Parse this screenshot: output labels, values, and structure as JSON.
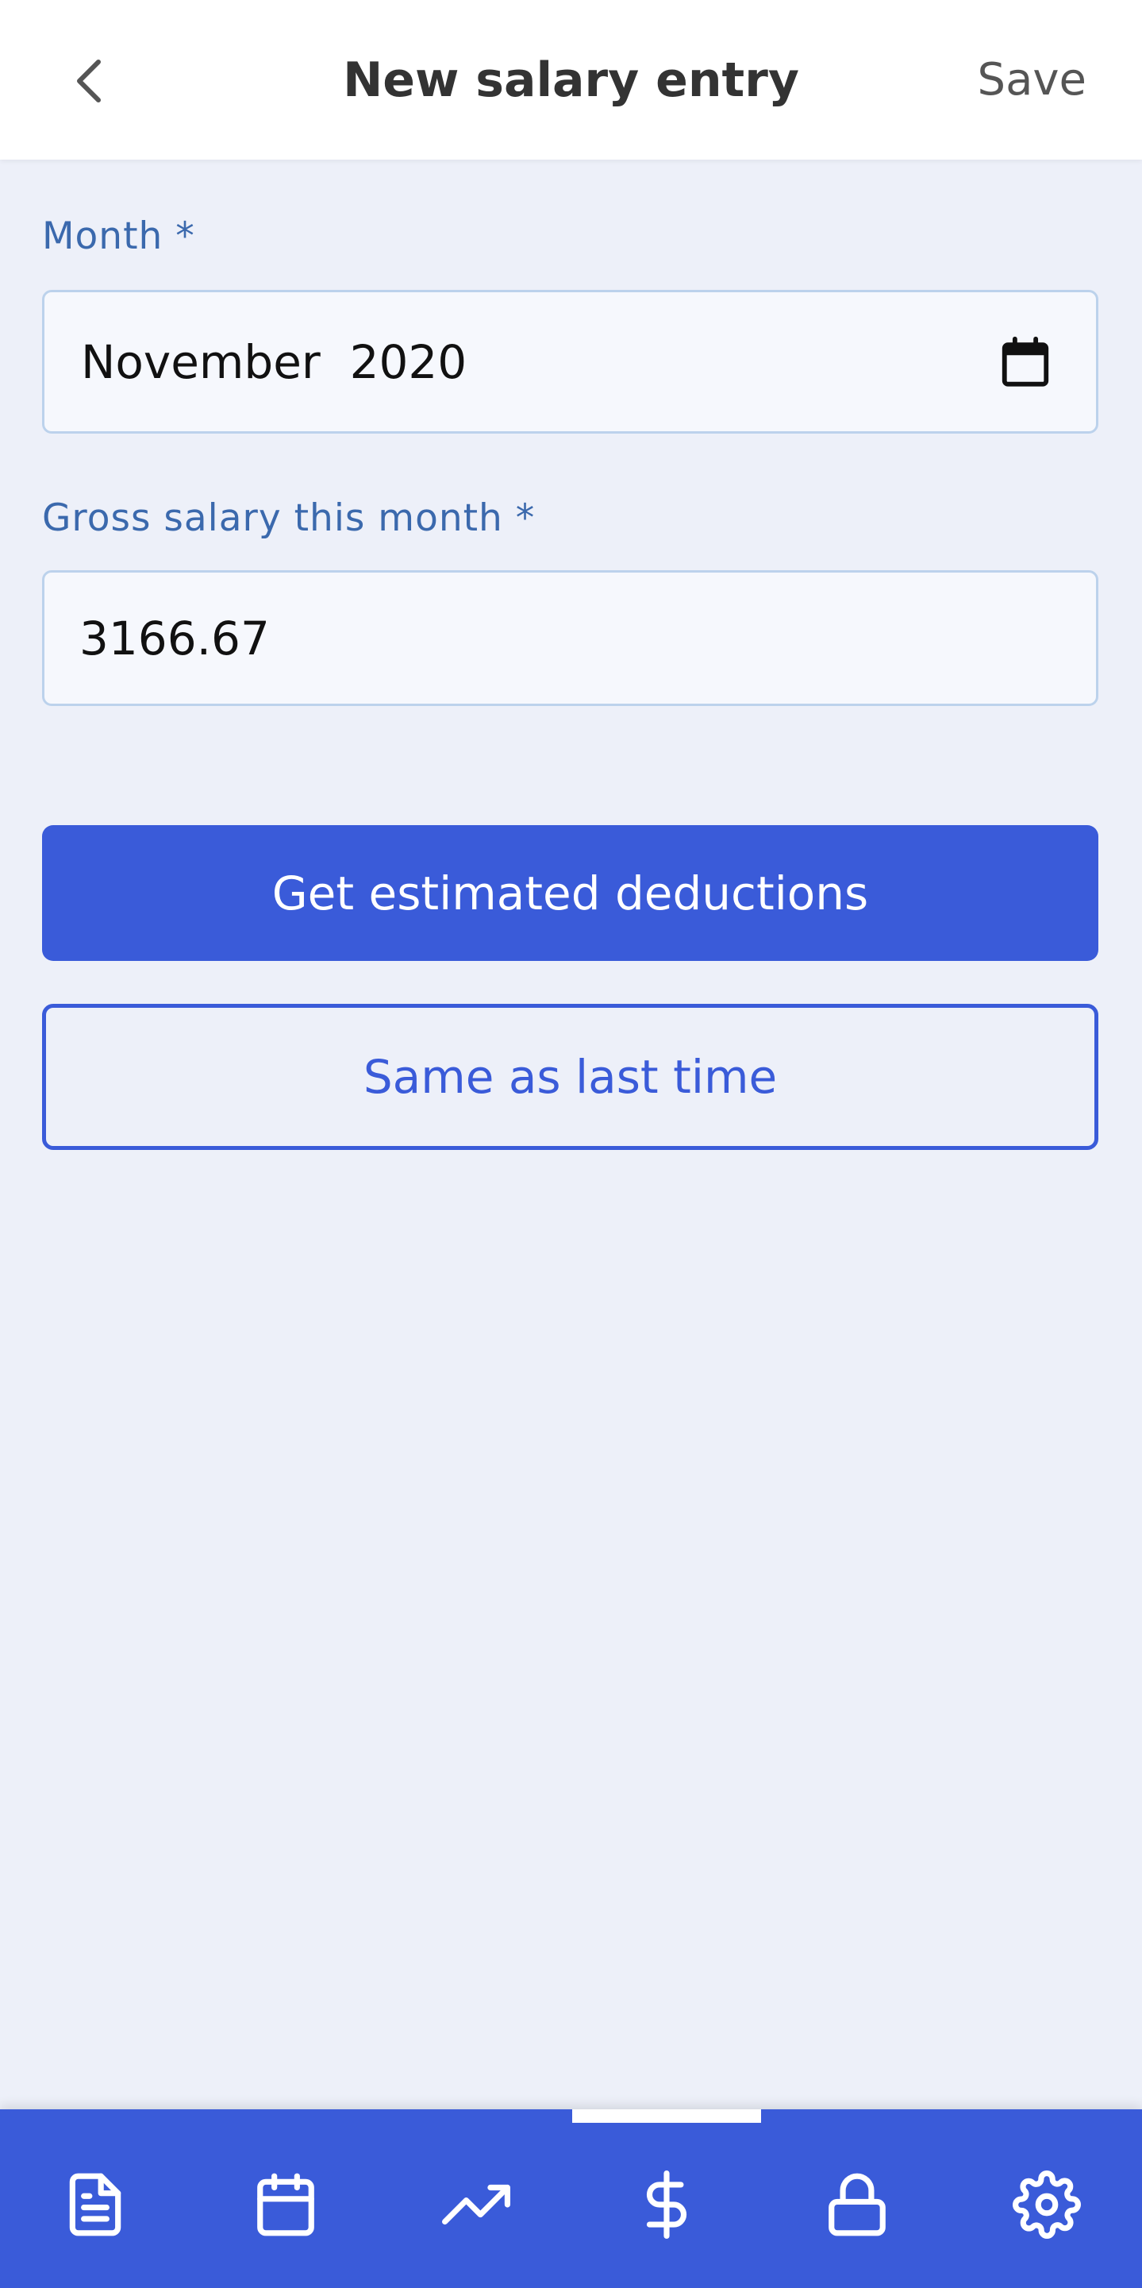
{
  "header": {
    "title": "New salary entry",
    "save_label": "Save",
    "back_icon": "chevron-left-icon"
  },
  "form": {
    "month": {
      "label": "Month *",
      "value": "November  2020",
      "icon": "calendar-icon"
    },
    "gross_salary": {
      "label": "Gross salary this month *",
      "value": "3166.67"
    }
  },
  "actions": {
    "estimate_label": "Get estimated deductions",
    "same_label": "Same as last time"
  },
  "bottom_nav": {
    "active_index": 3,
    "items": [
      {
        "icon": "document-icon"
      },
      {
        "icon": "calendar-icon"
      },
      {
        "icon": "trending-up-icon"
      },
      {
        "icon": "dollar-icon"
      },
      {
        "icon": "lock-icon"
      },
      {
        "icon": "gear-icon"
      }
    ]
  },
  "colors": {
    "accent": "#3a5bd9",
    "background": "#edf0f9",
    "label": "#3b69ad",
    "input_border": "#bcd2ec"
  }
}
